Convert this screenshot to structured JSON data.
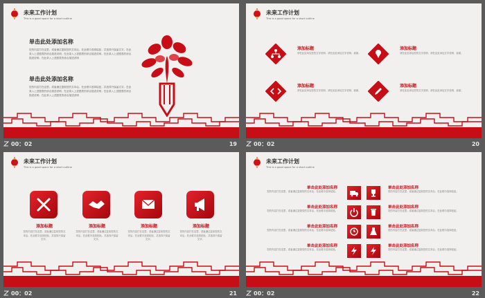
{
  "slides": [
    {
      "number": "19",
      "timer": "00：02",
      "title": "未来工作计划",
      "subtitle": "This is a good space for a short outline",
      "sections": [
        {
          "heading": "单击此处添加名称",
          "body": "您的内容打在这里，或者通过复制您的文本后，在此框中选择粘贴，并选择只保留文字。在此录入上述图表的综合描述说明，在此录入上述图表的综合描述说明，在此录入上述图表的综合描述说明，在此录入上述图表的综合描述说明"
        },
        {
          "heading": "单击此处添加名称",
          "body": "您的内容打在这里，或者通过复制您的文本后，在此框中选择粘贴，并选择只保留文字。在此录入上述图表的综合描述说明，在此录入上述图表的综合描述说明，在此录入上述图表的综合描述说明，在此录入上述图表的综合描述说明"
        }
      ]
    },
    {
      "number": "20",
      "timer": "00：02",
      "title": "未来工作计划",
      "subtitle": "This is a good space for a short outline",
      "items": [
        {
          "icon": "sitemap-icon",
          "label": "添加标题",
          "text": "请在此处添加您的文字说明，请在此处添加文字说明，谢谢。"
        },
        {
          "icon": "ice-cream-icon",
          "label": "添加标题",
          "text": "请在此处添加您的文字说明，请在此处添加文字说明，谢谢。"
        },
        {
          "icon": "code-icon",
          "label": "添加标题",
          "text": "请在此处添加您的文字说明，请在此处添加文字说明，谢谢。"
        },
        {
          "icon": "pencil-icon",
          "label": "添加标题",
          "text": "请在此处添加您的文字说明，请在此处添加文字说明，谢谢。"
        }
      ]
    },
    {
      "number": "21",
      "timer": "00：02",
      "title": "未来工作计划",
      "subtitle": "This is a good space for a short outline",
      "cards": [
        {
          "icon": "tools-icon",
          "label": "添加标题",
          "text": "您的内容打在这里，或者通过复制您的文本后，在此框中选择粘贴，并选择只保留文字。"
        },
        {
          "icon": "handshake-icon",
          "label": "添加标题",
          "text": "您的内容打在这里，或者通过复制您的文本后，在此框中选择粘贴，并选择只保留文字。"
        },
        {
          "icon": "envelope-icon",
          "label": "添加标题",
          "text": "您的内容打在这里，或者通过复制您的文本后，在此框中选择粘贴，并选择只保留文字。"
        },
        {
          "icon": "bullhorn-icon",
          "label": "添加标题",
          "text": "您的内容打在这里，或者通过复制您的文本后，在此框中选择粘贴，并选择只保留文字。"
        }
      ]
    },
    {
      "number": "22",
      "timer": "00：02",
      "title": "未来工作计划",
      "subtitle": "This is a good space for a short outline",
      "left_rows": [
        {
          "label": "单击此处添加名称",
          "text": "您的内容打在这里，或者通过复制您的文本后，在此框中选择粘贴。"
        },
        {
          "label": "单击此处添加名称",
          "text": "您的内容打在这里，或者通过复制您的文本后，在此框中选择粘贴。"
        },
        {
          "label": "单击此处添加名称",
          "text": "您的内容打在这里，或者通过复制您的文本后，在此框中选择粘贴。"
        },
        {
          "label": "单击此处添加名称",
          "text": "您的内容打在这里，或者通过复制您的文本后，在此框中选择粘贴。"
        }
      ],
      "right_rows": [
        {
          "label": "单击此处添加名称",
          "text": "您的内容打在这里，或者通过复制您的文本后，在此框中选择粘贴。"
        },
        {
          "label": "单击此处添加名称",
          "text": "您的内容打在这里，或者通过复制您的文本后，在此框中选择粘贴。"
        },
        {
          "label": "单击此处添加名称",
          "text": "您的内容打在这里，或者通过复制您的文本后，在此框中选择粘贴。"
        },
        {
          "label": "单击此处添加名称",
          "text": "您的内容打在这里，或者通过复制您的文本后，在此框中选择粘贴。"
        }
      ],
      "icons": [
        "truck-icon",
        "trophy-icon",
        "power-icon",
        "trash-icon",
        "clock-icon",
        "flask-icon",
        "bolt-icon",
        "bolt-icon"
      ]
    }
  ],
  "colors": {
    "accent": "#c70e16",
    "background": "#5b5b5b",
    "slide_bg": "#f2f0ee"
  }
}
